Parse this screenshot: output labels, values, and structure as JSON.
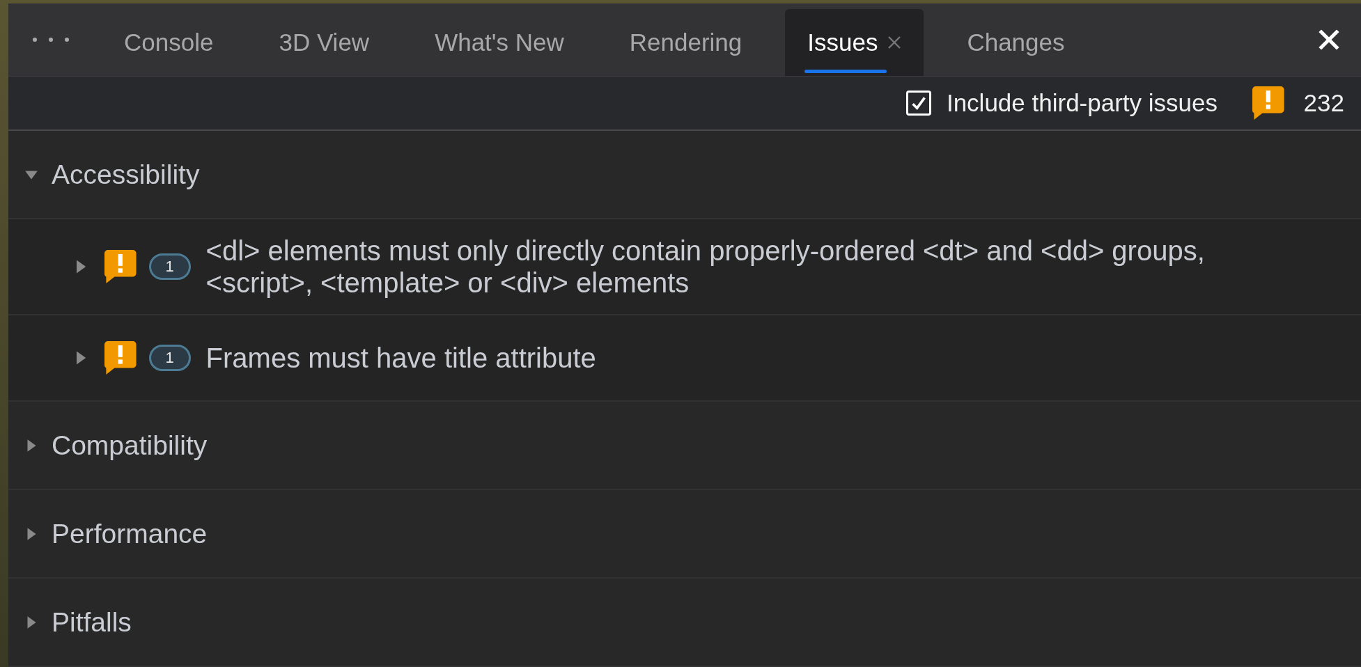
{
  "tabs": [
    {
      "label": "Console",
      "selected": false,
      "closable": false
    },
    {
      "label": "3D View",
      "selected": false,
      "closable": false
    },
    {
      "label": "What's New",
      "selected": false,
      "closable": false
    },
    {
      "label": "Rendering",
      "selected": false,
      "closable": false
    },
    {
      "label": "Issues",
      "selected": true,
      "closable": true
    },
    {
      "label": "Changes",
      "selected": false,
      "closable": false
    }
  ],
  "toolbar": {
    "third_party": {
      "label": "Include third-party issues",
      "checked": true
    },
    "issue_count": "232"
  },
  "sections": [
    {
      "title": "Accessibility",
      "expanded": true,
      "issues": [
        {
          "count": "1",
          "title": "<dl> elements must only directly contain properly-ordered <dt> and <dd> groups, <script>, <template> or <div> elements",
          "expanded": false
        },
        {
          "count": "1",
          "title": "Frames must have title attribute",
          "expanded": false
        }
      ]
    },
    {
      "title": "Compatibility",
      "expanded": false
    },
    {
      "title": "Performance",
      "expanded": false
    },
    {
      "title": "Pitfalls",
      "expanded": false
    }
  ]
}
